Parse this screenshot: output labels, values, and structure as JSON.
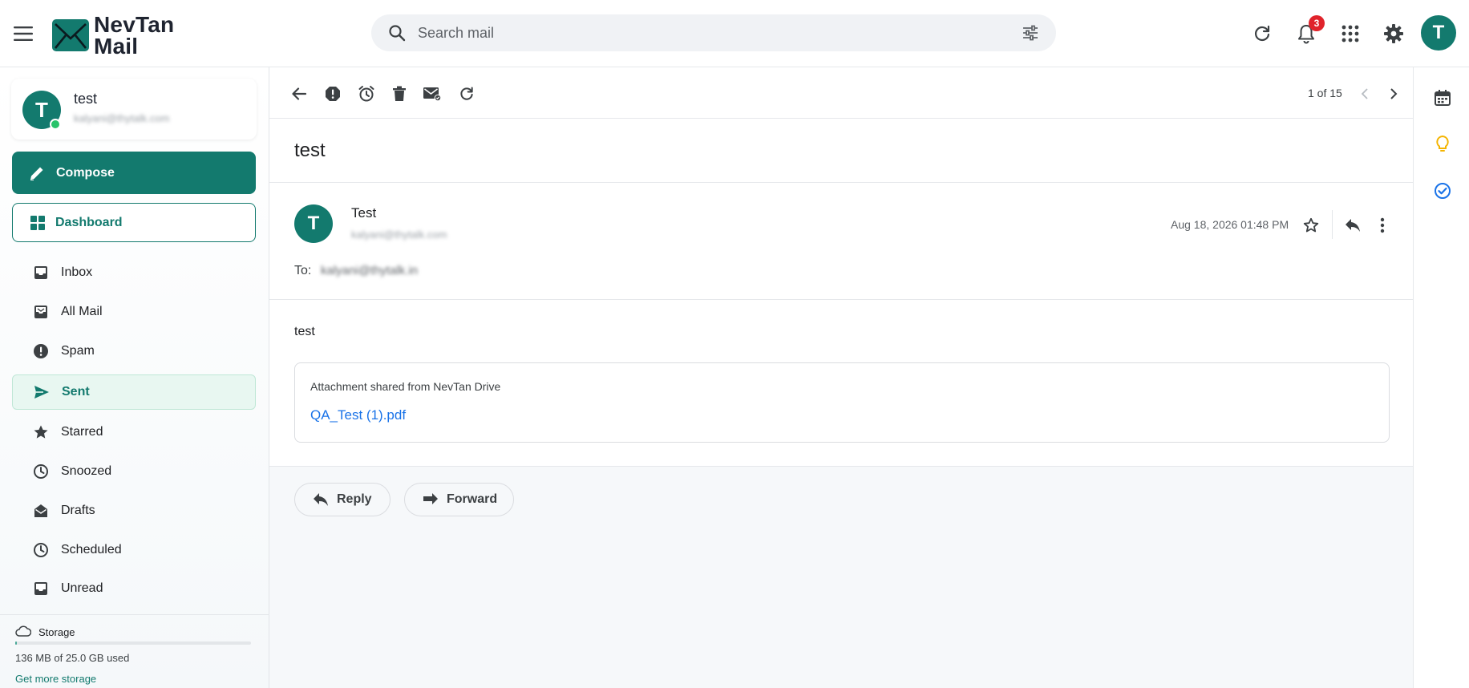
{
  "app": {
    "logo_line1": "NevTan",
    "logo_line2": "Mail"
  },
  "search": {
    "placeholder": "Search mail"
  },
  "notifications": {
    "count": "3"
  },
  "account": {
    "initial": "T",
    "name": "test",
    "email": "kalyani@thytalk.com"
  },
  "sidebar": {
    "compose_label": "Compose",
    "dashboard_label": "Dashboard",
    "items": [
      {
        "label": "Inbox",
        "icon": "inbox-icon"
      },
      {
        "label": "All Mail",
        "icon": "all-mail-icon"
      },
      {
        "label": "Spam",
        "icon": "spam-icon"
      },
      {
        "label": "Sent",
        "icon": "send-icon",
        "active": true
      },
      {
        "label": "Starred",
        "icon": "star-icon"
      },
      {
        "label": "Snoozed",
        "icon": "clock-icon"
      },
      {
        "label": "Drafts",
        "icon": "drafts-icon"
      },
      {
        "label": "Scheduled",
        "icon": "clock-icon"
      },
      {
        "label": "Unread",
        "icon": "inbox-icon"
      }
    ]
  },
  "storage": {
    "title": "Storage",
    "used_text": "136 MB of 25.0 GB used",
    "used_fraction": 0.005,
    "link": "Get more storage"
  },
  "toolbar": {
    "pager": "1 of 15"
  },
  "message": {
    "subject": "test",
    "sender_initial": "T",
    "sender_name": "Test",
    "sender_email": "kalyani@thytalk.com",
    "to_label": "To:",
    "to_value": "kalyani@thytalk.in",
    "date": "Aug 18, 2026 01:48 PM",
    "body": "test",
    "attachment_title": "Attachment shared from NevTan Drive",
    "attachment_name": "QA_Test (1).pdf"
  },
  "actions": {
    "reply": "Reply",
    "forward": "Forward"
  },
  "colors": {
    "brand": "#137a6e",
    "active_bg": "#e8f7f1",
    "link": "#1a73e8",
    "badge": "#e0232b",
    "keep": "#f4b400",
    "tasks": "#1a73e8"
  }
}
